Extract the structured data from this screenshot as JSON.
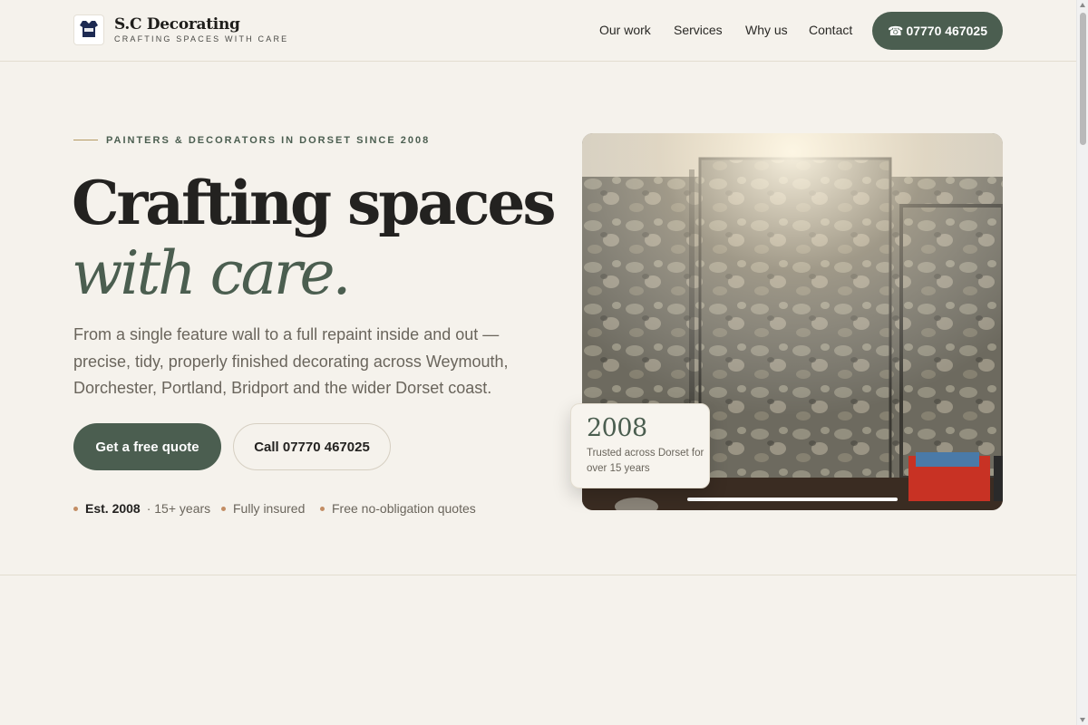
{
  "brand": {
    "name": "S.C Decorating",
    "tagline": "CRAFTING SPACES WITH CARE",
    "badge_text": "S.C Decorating"
  },
  "nav": {
    "items": [
      {
        "label": "Our work"
      },
      {
        "label": "Services"
      },
      {
        "label": "Why us"
      },
      {
        "label": "Contact"
      }
    ],
    "phone_icon": "☎",
    "phone": "07770 467025"
  },
  "hero": {
    "eyebrow": "PAINTERS & DECORATORS IN DORSET SINCE 2008",
    "headline_line1": "Crafting spaces",
    "headline_line2": "with care.",
    "lede": "From a single feature wall to a full repaint inside and out — precise, tidy, properly finished decorating across Weymouth, Dorchester, Portland, Bridport and the wider Dorset coast.",
    "primary_cta": "Get a free quote",
    "secondary_cta": "Call 07770 467025",
    "trust": [
      {
        "bold": "Est. 2008",
        "text": "· 15+ years"
      },
      {
        "text": "Fully insured"
      },
      {
        "text": "Free no-obligation quotes"
      }
    ]
  },
  "stat": {
    "value": "2008",
    "text": "Trusted across Dorset for over 15 years"
  },
  "colors": {
    "accent": "#4b5e50",
    "background": "#f5f2ec",
    "dot": "#c38d64",
    "rule": "#b59b63"
  },
  "icons": {
    "phone": "phone-icon",
    "logo": "logo-badge-icon"
  }
}
